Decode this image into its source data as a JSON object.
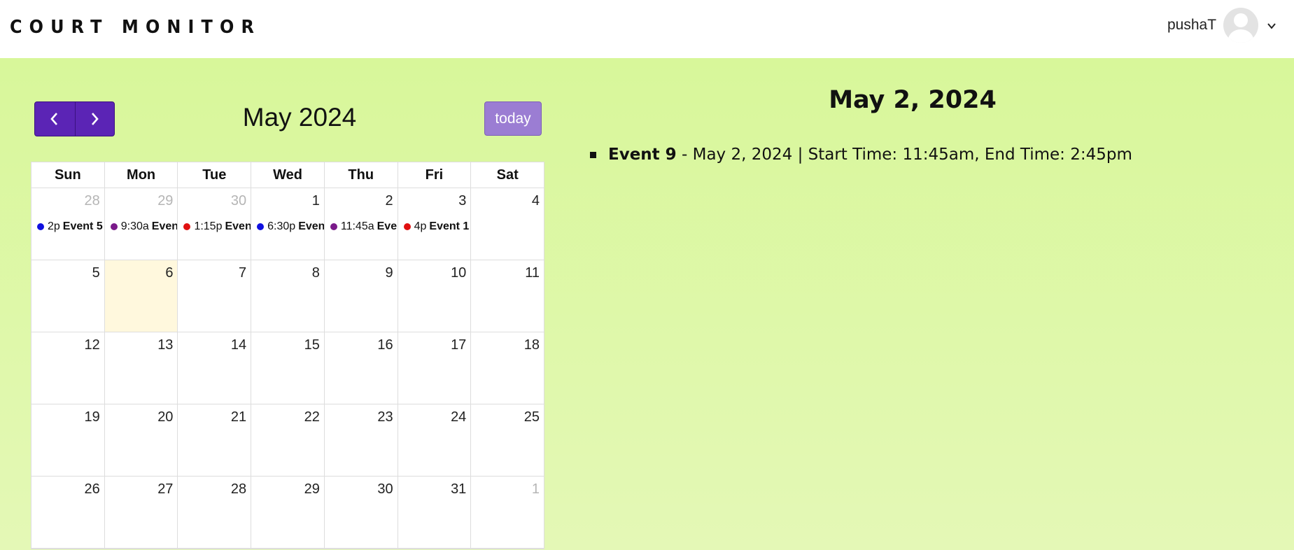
{
  "header": {
    "logo": "COURT MONITOR",
    "user_name": "pushaT"
  },
  "calendar": {
    "title": "May 2024",
    "today_label": "today",
    "days_of_week": [
      "Sun",
      "Mon",
      "Tue",
      "Wed",
      "Thu",
      "Fri",
      "Sat"
    ],
    "weeks": [
      [
        {
          "n": "28",
          "other": true,
          "event": {
            "time": "2p",
            "title": "Event 5",
            "color": "#1010e0"
          }
        },
        {
          "n": "29",
          "other": true,
          "event": {
            "time": "9:30a",
            "title": "Event",
            "color": "#7a1a8a"
          }
        },
        {
          "n": "30",
          "other": true,
          "event": {
            "time": "1:15p",
            "title": "Event",
            "color": "#e01010"
          }
        },
        {
          "n": "1",
          "event": {
            "time": "6:30p",
            "title": "Event",
            "color": "#1010e0"
          }
        },
        {
          "n": "2",
          "event": {
            "time": "11:45a",
            "title": "Event",
            "color": "#7a1a8a"
          }
        },
        {
          "n": "3",
          "event": {
            "time": "4p",
            "title": "Event 1",
            "color": "#e01010"
          }
        },
        {
          "n": "4"
        }
      ],
      [
        {
          "n": "5"
        },
        {
          "n": "6",
          "today": true
        },
        {
          "n": "7"
        },
        {
          "n": "8"
        },
        {
          "n": "9"
        },
        {
          "n": "10"
        },
        {
          "n": "11"
        }
      ],
      [
        {
          "n": "12"
        },
        {
          "n": "13"
        },
        {
          "n": "14"
        },
        {
          "n": "15"
        },
        {
          "n": "16"
        },
        {
          "n": "17"
        },
        {
          "n": "18"
        }
      ],
      [
        {
          "n": "19"
        },
        {
          "n": "20"
        },
        {
          "n": "21"
        },
        {
          "n": "22"
        },
        {
          "n": "23"
        },
        {
          "n": "24"
        },
        {
          "n": "25"
        }
      ],
      [
        {
          "n": "26"
        },
        {
          "n": "27"
        },
        {
          "n": "28"
        },
        {
          "n": "29"
        },
        {
          "n": "30"
        },
        {
          "n": "31"
        },
        {
          "n": "1",
          "other": true
        }
      ]
    ]
  },
  "detail": {
    "title": "May 2, 2024",
    "events": [
      {
        "title": "Event 9",
        "text": " - May 2, 2024 | Start Time: 11:45am, End Time: 2:45pm"
      }
    ]
  },
  "icons": {
    "prev": "chevron-left-icon",
    "next": "chevron-right-icon",
    "user_menu": "chevron-down-icon",
    "avatar": "user-avatar-icon"
  }
}
